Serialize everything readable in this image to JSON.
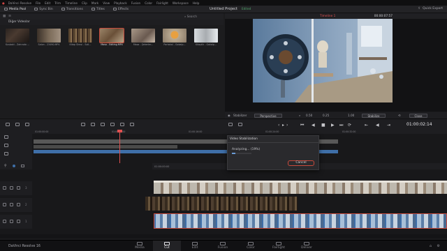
{
  "menu": {
    "items": [
      "DaVinci Resolve",
      "File",
      "Edit",
      "Trim",
      "Timeline",
      "Clip",
      "Mark",
      "View",
      "Playback",
      "Fusion",
      "Color",
      "Fairlight",
      "Workspace",
      "Help"
    ]
  },
  "toolbar": {
    "media_pool": "Media Pool",
    "sync_bin": "Sync Bin",
    "transitions": "Transitions",
    "titles": "Titles",
    "effects": "Effects",
    "project_title": "Untitled Project",
    "project_status": "Edited",
    "quick_export": "Quick Export"
  },
  "media_pool": {
    "search_label": "Search",
    "bin_name": "Diğer Videolar",
    "clips": [
      {
        "name": "Kusbaki - Zahrada ...",
        "selected": false,
        "color": "#3a3028"
      },
      {
        "name": "Salon - 23490.MP4",
        "selected": false,
        "color": "#6a5a48"
      },
      {
        "name": "Kitap Sirasi - Soli...",
        "selected": false,
        "color": "#5e4a38"
      },
      {
        "name": "Masa - Editing.MP4",
        "selected": true,
        "color": "#7a6048"
      },
      {
        "name": "Masa - Şekerler...",
        "selected": false,
        "color": "#8a7a68"
      },
      {
        "name": "Portakal - Gokalp...",
        "selected": false,
        "color": "#c09050"
      },
      {
        "name": "Kitaplik - Gokalp...",
        "selected": false,
        "color": "#a0a4a8"
      },
      {
        "name": "Salon - Şekerler...",
        "selected": false,
        "color": "#7a7068"
      }
    ]
  },
  "viewer": {
    "timeline_name": "Timeline 1",
    "timecode_top": "00:00:07:57",
    "timecode_main": "01:00:02:14"
  },
  "stabilizer": {
    "label": "Stabilizer",
    "mode": "Perspective",
    "smooth": "0.50",
    "strength": "0.25",
    "zoom": "1.00",
    "stabilize_button": "Stabilize",
    "close_button": "Close"
  },
  "upper_timeline": {
    "ticks": [
      "01:00:00:00",
      "01:00:08:00",
      "01:00:16:00",
      "01:00:24:00",
      "01:00:32:00"
    ]
  },
  "lower_timeline": {
    "ticks": [
      "01:00:00:00"
    ],
    "tracks": [
      "3",
      "2",
      "1"
    ]
  },
  "dialog": {
    "title": "Video Stabilization",
    "message": "Analyzing... (19%)",
    "progress": 0.19,
    "cancel": "Cancel"
  },
  "pages": {
    "app_name": "DaVinci Resolve 16",
    "items": [
      "Media",
      "Cut",
      "Edit",
      "Fusion",
      "Color",
      "Fairlight",
      "Deliver"
    ],
    "active": "Cut"
  },
  "colors": {
    "accent": "#c84a3c",
    "playhead": "#e05050",
    "video_clip": "#3f6fa8",
    "status_green": "#4fa36a"
  }
}
